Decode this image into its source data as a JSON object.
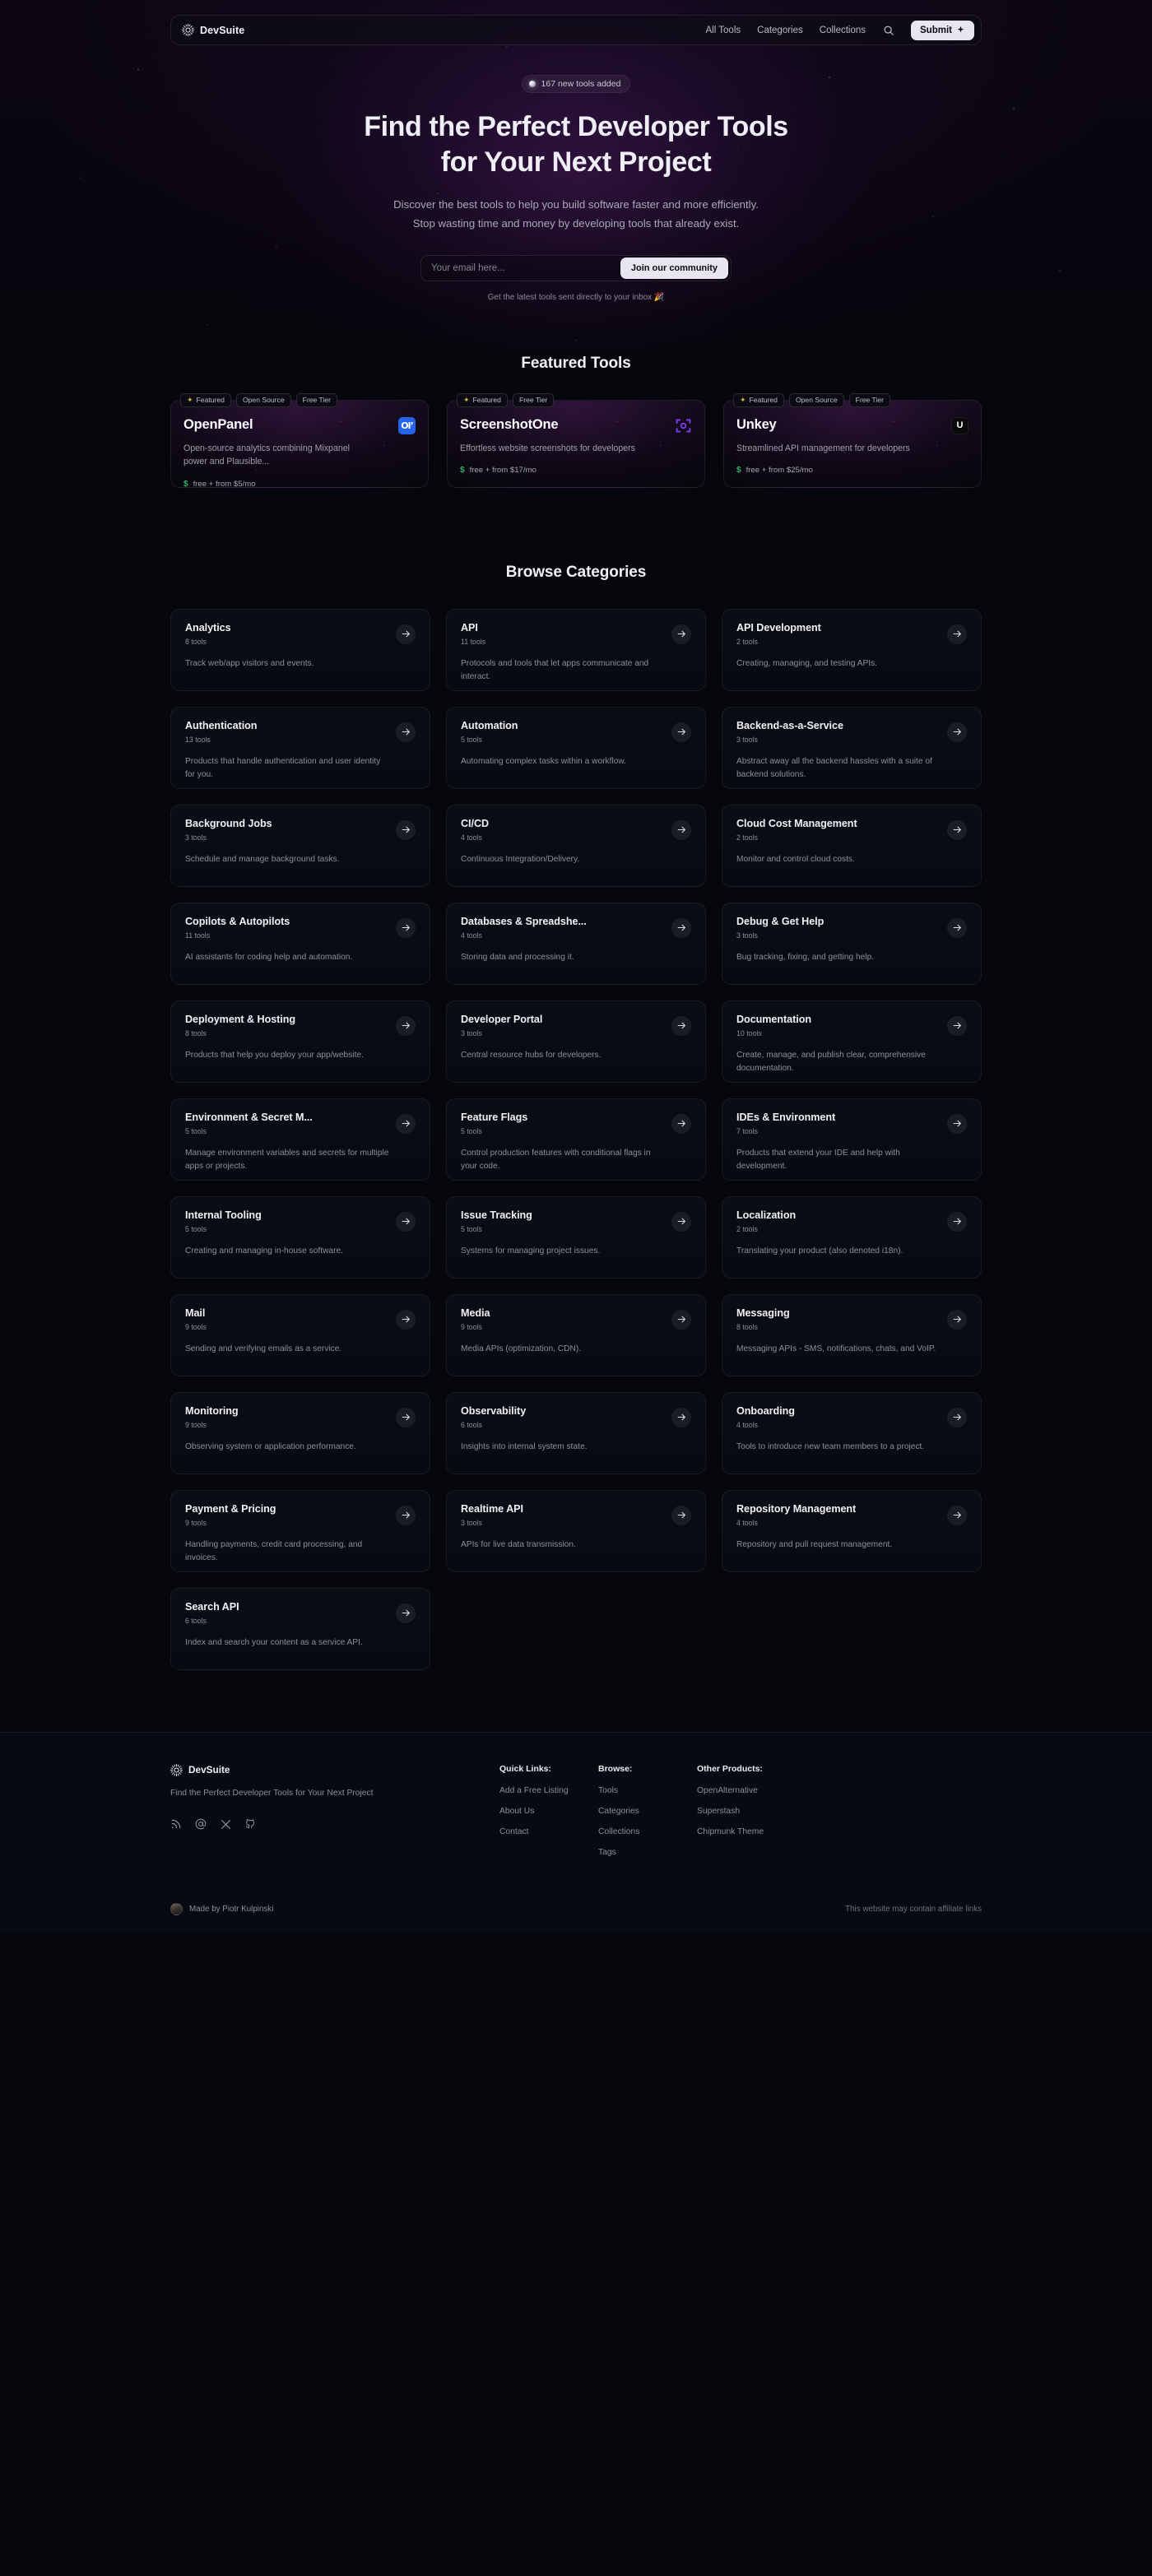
{
  "nav": {
    "brand": "DevSuite",
    "brand_icon": "sun-burst-logo-icon",
    "links": [
      "All Tools",
      "Categories",
      "Collections"
    ],
    "search_icon": "search-icon",
    "submit_label": "Submit",
    "submit_icon": "sparkle-icon"
  },
  "hero": {
    "badge": "167 new tools added",
    "title_line1": "Find the Perfect Developer Tools",
    "title_line2": "for Your Next Project",
    "sub_line1": "Discover the best tools to help you build software faster and more efficiently.",
    "sub_line2": "Stop wasting time and money by developing tools that already exist.",
    "email_placeholder": "Your email here...",
    "email_value": "",
    "cta_label": "Join our community",
    "note": "Get the latest tools sent directly to your inbox 🎉"
  },
  "featured": {
    "title": "Featured Tools",
    "tools": [
      {
        "name": "OpenPanel",
        "logo_text": "OI’",
        "logo_icon": "openpanel-logo-icon",
        "tags": [
          "Featured",
          "Open Source",
          "Free Tier"
        ],
        "desc": "Open-source analytics combining Mixpanel power and Plausible...",
        "price": "free + from $5/mo"
      },
      {
        "name": "ScreenshotOne",
        "logo_text": "⧉",
        "logo_icon": "screenshotone-logo-icon",
        "tags": [
          "Featured",
          "Free Tier"
        ],
        "desc": "Effortless website screenshots for developers",
        "price": "free + from $17/mo"
      },
      {
        "name": "Unkey",
        "logo_text": "U",
        "logo_icon": "unkey-logo-icon",
        "tags": [
          "Featured",
          "Open Source",
          "Free Tier"
        ],
        "desc": "Streamlined API management for developers",
        "price": "free + from $25/mo"
      }
    ]
  },
  "categories": {
    "title": "Browse Categories",
    "arrow_icon": "arrow-right-icon",
    "items": [
      {
        "name": "Analytics",
        "count": "8 tools",
        "desc": "Track web/app visitors and events."
      },
      {
        "name": "API",
        "count": "11 tools",
        "desc": "Protocols and tools that let apps communicate and interact."
      },
      {
        "name": "API Development",
        "count": "2 tools",
        "desc": "Creating, managing, and testing APIs."
      },
      {
        "name": "Authentication",
        "count": "13 tools",
        "desc": "Products that handle authentication and user identity for you."
      },
      {
        "name": "Automation",
        "count": "5 tools",
        "desc": "Automating complex tasks within a workflow."
      },
      {
        "name": "Backend-as-a-Service",
        "count": "3 tools",
        "desc": "Abstract away all the backend hassles with a suite of backend solutions."
      },
      {
        "name": "Background Jobs",
        "count": "3 tools",
        "desc": "Schedule and manage background tasks."
      },
      {
        "name": "CI/CD",
        "count": "4 tools",
        "desc": "Continuous Integration/Delivery."
      },
      {
        "name": "Cloud Cost Management",
        "count": "2 tools",
        "desc": "Monitor and control cloud costs."
      },
      {
        "name": "Copilots & Autopilots",
        "count": "11 tools",
        "desc": "AI assistants for coding help and automation."
      },
      {
        "name": "Databases & Spreadshe...",
        "count": "4 tools",
        "desc": "Storing data and processing it."
      },
      {
        "name": "Debug & Get Help",
        "count": "3 tools",
        "desc": "Bug tracking, fixing, and getting help."
      },
      {
        "name": "Deployment & Hosting",
        "count": "8 tools",
        "desc": "Products that help you deploy your app/website."
      },
      {
        "name": "Developer Portal",
        "count": "3 tools",
        "desc": "Central resource hubs for developers."
      },
      {
        "name": "Documentation",
        "count": "10 tools",
        "desc": "Create, manage, and publish clear, comprehensive documentation."
      },
      {
        "name": "Environment & Secret M...",
        "count": "5 tools",
        "desc": "Manage environment variables and secrets for multiple apps or projects."
      },
      {
        "name": "Feature Flags",
        "count": "5 tools",
        "desc": "Control production features with conditional flags in your code."
      },
      {
        "name": "IDEs & Environment",
        "count": "7 tools",
        "desc": "Products that extend your IDE and help with development."
      },
      {
        "name": "Internal Tooling",
        "count": "5 tools",
        "desc": "Creating and managing in-house software."
      },
      {
        "name": "Issue Tracking",
        "count": "5 tools",
        "desc": "Systems for managing project issues."
      },
      {
        "name": "Localization",
        "count": "2 tools",
        "desc": "Translating your product (also denoted i18n)."
      },
      {
        "name": "Mail",
        "count": "9 tools",
        "desc": "Sending and verifying emails as a service."
      },
      {
        "name": "Media",
        "count": "9 tools",
        "desc": "Media APIs (optimization, CDN)."
      },
      {
        "name": "Messaging",
        "count": "8 tools",
        "desc": "Messaging APIs - SMS, notifications, chats, and VoIP."
      },
      {
        "name": "Monitoring",
        "count": "9 tools",
        "desc": "Observing system or application performance."
      },
      {
        "name": "Observability",
        "count": "6 tools",
        "desc": "Insights into internal system state."
      },
      {
        "name": "Onboarding",
        "count": "4 tools",
        "desc": "Tools to introduce new team members to a project."
      },
      {
        "name": "Payment & Pricing",
        "count": "9 tools",
        "desc": "Handling payments, credit card processing, and invoices."
      },
      {
        "name": "Realtime API",
        "count": "3 tools",
        "desc": "APIs for live data transmission."
      },
      {
        "name": "Repository Management",
        "count": "4 tools",
        "desc": "Repository and pull request management."
      },
      {
        "name": "Search API",
        "count": "6 tools",
        "desc": "Index and search your content as a service API."
      }
    ]
  },
  "footer": {
    "brand": "DevSuite",
    "tagline": "Find the Perfect Developer Tools for Your Next Project",
    "socials": [
      "rss-icon",
      "at-email-icon",
      "x-twitter-icon",
      "github-icon"
    ],
    "columns": [
      {
        "title": "Quick Links:",
        "links": [
          "Add a Free Listing",
          "About Us",
          "Contact"
        ]
      },
      {
        "title": "Browse:",
        "links": [
          "Tools",
          "Categories",
          "Collections",
          "Tags"
        ]
      },
      {
        "title": "Other Products:",
        "links": [
          "OpenAlternative",
          "Superstash",
          "Chipmunk Theme"
        ]
      }
    ],
    "made_by": "Made by Piotr Kulpinski",
    "affiliate": "This website may contain affiliate links"
  }
}
